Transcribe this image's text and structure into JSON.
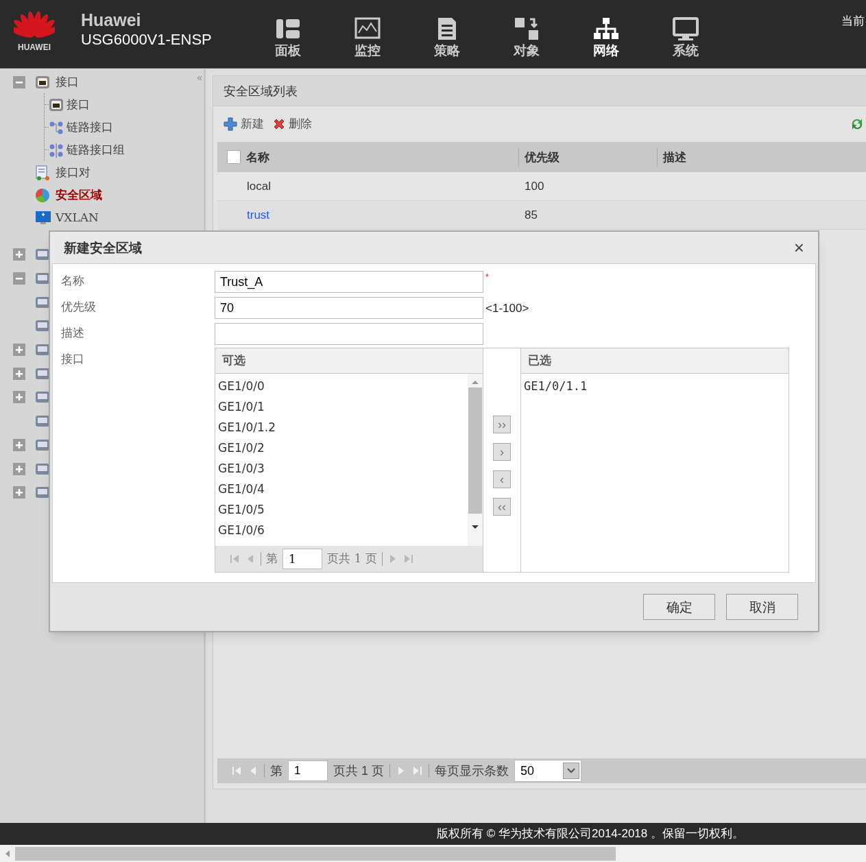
{
  "header": {
    "brand": "HUAWEI",
    "title": "Huawei",
    "subtitle": "USG6000V1-ENSP",
    "corner_text": "当前",
    "nav": [
      {
        "label": "面板",
        "selected": false
      },
      {
        "label": "监控",
        "selected": false
      },
      {
        "label": "策略",
        "selected": false
      },
      {
        "label": "对象",
        "selected": false
      },
      {
        "label": "网络",
        "selected": true
      },
      {
        "label": "系统",
        "selected": false
      }
    ]
  },
  "sidebar": {
    "collapse_glyph": "«",
    "tree": [
      {
        "label": "接口",
        "expanded": true,
        "selected": false,
        "children": [
          {
            "label": "接口",
            "selected": false
          },
          {
            "label": "链路接口",
            "selected": false
          },
          {
            "label": "链路接口组",
            "selected": false
          }
        ]
      },
      {
        "label": "接口对",
        "selected": false
      },
      {
        "label": "安全区域",
        "selected": true
      },
      {
        "label": "VXLAN",
        "selected": false
      }
    ],
    "hidden_rows": [
      {
        "kind": "group",
        "expanded": false
      },
      {
        "kind": "group",
        "expanded": true
      },
      {
        "kind": "leaf"
      },
      {
        "kind": "leaf"
      },
      {
        "kind": "group",
        "expanded": false
      },
      {
        "kind": "group",
        "expanded": false
      },
      {
        "kind": "group",
        "expanded": false
      },
      {
        "kind": "leaf"
      },
      {
        "kind": "group",
        "expanded": false
      },
      {
        "kind": "group",
        "expanded": false
      },
      {
        "kind": "group",
        "expanded": false
      }
    ]
  },
  "panel": {
    "title": "安全区域列表",
    "toolbar": [
      {
        "label": "新建",
        "kind": "add"
      },
      {
        "label": "删除",
        "kind": "delete"
      }
    ],
    "select_all_checked": false,
    "columns": [
      "名称",
      "优先级",
      "描述"
    ],
    "rows": [
      {
        "cells": [
          "local",
          "100"
        ],
        "selected": false
      },
      {
        "cells": [
          "trust",
          "85"
        ],
        "selected": true
      }
    ],
    "pager": {
      "page_prefix": "第",
      "page": "1",
      "page_suffix": "页共 1 页",
      "per_page_label": "每页显示条数",
      "per_page": "50"
    }
  },
  "dialog": {
    "title": "新建安全区域",
    "close": "×",
    "required_mark": "*",
    "fields": [
      {
        "label": "名称",
        "value": "Trust_A",
        "required": true
      },
      {
        "label": "优先级",
        "value": "70",
        "required": false,
        "hint": "<1-100>"
      },
      {
        "label": "描述",
        "required": false
      },
      {
        "label": "接口",
        "kind": "transfer"
      }
    ],
    "available": {
      "title": "可选",
      "items": [
        "GE1/0/0",
        "GE1/0/1",
        "GE1/0/1.2",
        "GE1/0/2",
        "GE1/0/3",
        "GE1/0/4",
        "GE1/0/5",
        "GE1/0/6"
      ],
      "pager": {
        "page_prefix": "第",
        "page": "1",
        "page_suffix": "页共 1 页"
      }
    },
    "move_buttons": [
      "››",
      "›",
      "‹",
      "‹‹"
    ],
    "chosen": {
      "title": "已选",
      "items": [
        "GE1/0/1.1"
      ]
    },
    "buttons": [
      "确定",
      "取消"
    ]
  },
  "footer": "版权所有 © 华为技术有限公司2014-2018 。保留一切权利。"
}
